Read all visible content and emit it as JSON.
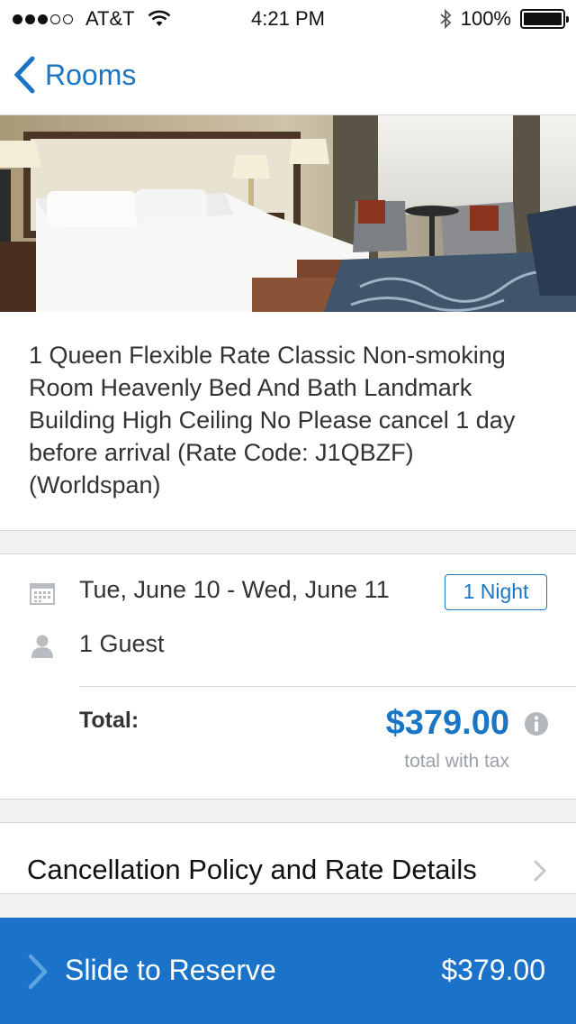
{
  "status_bar": {
    "carrier": "AT&T",
    "time": "4:21 PM",
    "battery": "100%",
    "signal_bars_filled": 3,
    "signal_bars_total": 5
  },
  "nav": {
    "back_label": "Rooms"
  },
  "room": {
    "description": "1 Queen Flexible Rate Classic Non-smoking Room Heavenly Bed And Bath Landmark Building High Ceiling No Please cancel 1 day before arrival (Rate Code: J1QBZF) (Worldspan)"
  },
  "stay": {
    "dates": "Tue, June 10 - Wed, June 11",
    "nights": "1 Night",
    "guests": "1 Guest"
  },
  "total": {
    "label": "Total:",
    "amount": "$379.00",
    "sub": "total with tax"
  },
  "policy": {
    "label": "Cancellation Policy and Rate Details"
  },
  "reserve": {
    "label": "Slide to Reserve",
    "price": "$379.00"
  },
  "colors": {
    "accent": "#1a75c4",
    "reserve_bar": "#1a73c9",
    "background": "#f2f2f4"
  }
}
